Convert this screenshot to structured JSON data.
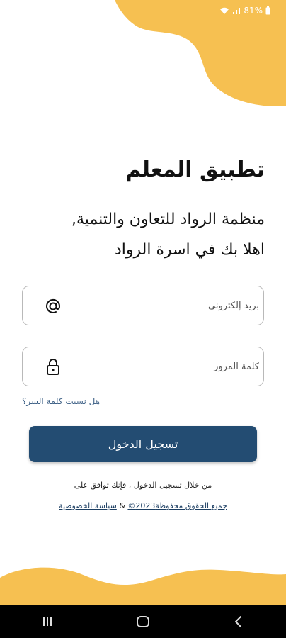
{
  "status_bar": {
    "battery": "81%"
  },
  "app": {
    "title": "تطبيق المعلم",
    "org_line": "منظمة الرواد للتعاون والتنمية,",
    "welcome_line": "اهلا بك في اسرة الرواد"
  },
  "form": {
    "email_placeholder": "بريد إلكتروني",
    "password_placeholder": "كلمة المرور",
    "forgot_label": "هل نسيت كلمة السر؟",
    "login_label": "تسجيل الدخول"
  },
  "footer": {
    "consent": "من خلال تسجيل الدخول ، فإنك توافق على",
    "copyright_link": "جميع الحقوق محفوظة2023©",
    "connector": "&",
    "privacy_link": "سياسة الخصوصية"
  },
  "colors": {
    "accent_yellow": "#f6c051",
    "button_blue": "#234c72",
    "link_blue": "#3c5f85"
  },
  "icons": {
    "email_icon": "at-icon",
    "password_icon": "lock-icon",
    "nav": [
      "recents-icon",
      "home-icon",
      "back-icon"
    ]
  }
}
